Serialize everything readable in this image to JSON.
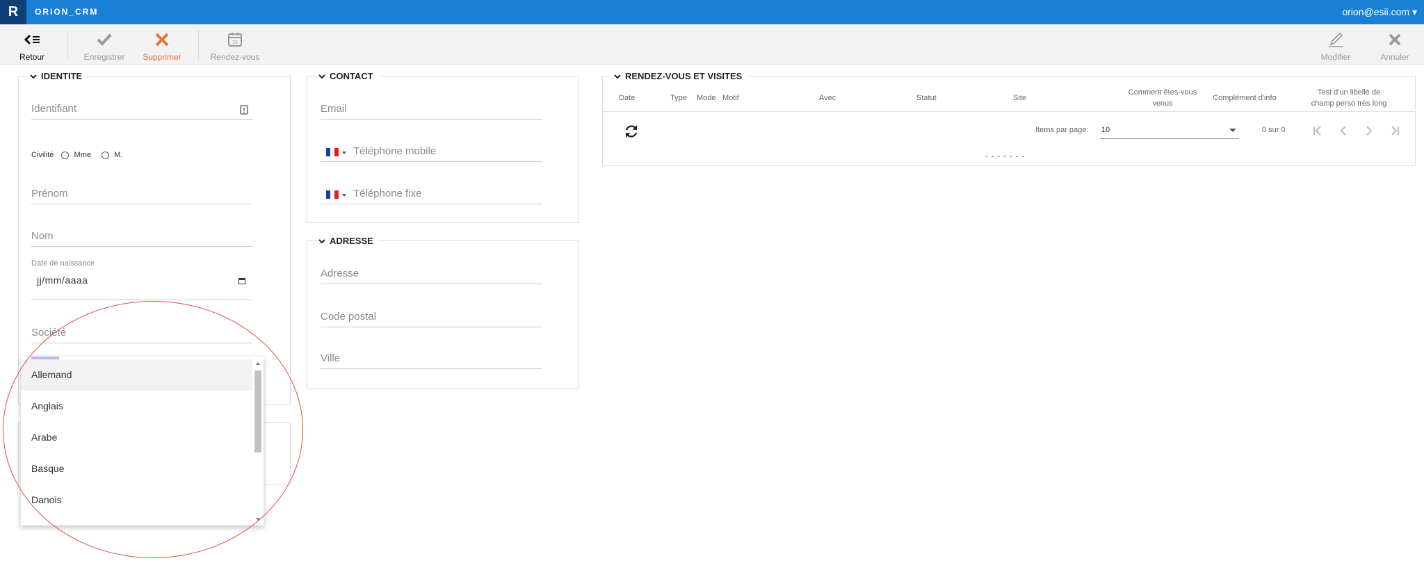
{
  "header": {
    "logo": "R",
    "app_name": "ORION_CRM",
    "user": "orion@esii.com ▾"
  },
  "toolbar": {
    "retour": "Retour",
    "enregistrer": "Enregistrer",
    "supprimer": "Supprimer",
    "rendez_vous": "Rendez-vous",
    "modifier": "Modifier",
    "annuler": "Annuler",
    "calendar_day": "15",
    "accent_delete": "#e8703a"
  },
  "identite": {
    "title": "IDENTITE",
    "identifiant": "Identifiant",
    "civilite": "Civilité",
    "mme": "Mme",
    "m": "M.",
    "prenom": "Prénom",
    "nom": "Nom",
    "date_label": "Date de naissance",
    "date_placeholder": "jj/mm/aaaa",
    "societe": "Société"
  },
  "contact": {
    "title": "CONTACT",
    "email": "Email",
    "tel_mobile": "Téléphone mobile",
    "tel_fixe": "Téléphone fixe"
  },
  "adresse": {
    "title": "ADRESSE",
    "adresse": "Adresse",
    "code_postal": "Code postal",
    "ville": "Ville"
  },
  "rdv": {
    "title": "RENDEZ-VOUS ET VISITES",
    "columns": {
      "date": "Date",
      "type": "Type",
      "mode": "Mode",
      "motif": "Motif",
      "avec": "Avec",
      "statut": "Statut",
      "site": "Site",
      "comment_1": "Comment êtes-vous",
      "comment_2": "venus",
      "complement": "Complément d'info",
      "test_1": "Test d'un libellé de",
      "test_2": "champ perso très long"
    },
    "items_per_page_label": "Items par page:",
    "items_per_page_value": "10",
    "range": "0 sur 0",
    "empty": "- - - - - - -"
  },
  "language_dropdown": {
    "options": [
      "Allemand",
      "Anglais",
      "Arabe",
      "Basque",
      "Danois"
    ]
  }
}
